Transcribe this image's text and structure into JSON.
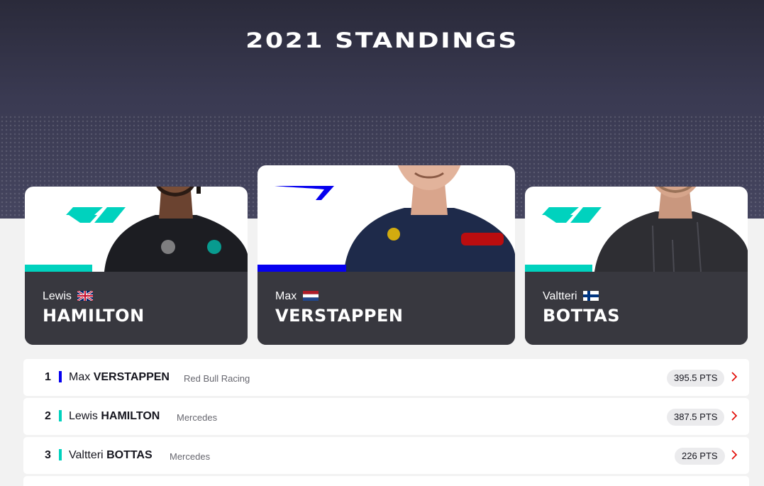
{
  "header": {
    "title": "2021 STANDINGS"
  },
  "colors": {
    "mercedes": "#00d2be",
    "redbull": "#0600ef",
    "card_dark": "#38383f",
    "accent_red": "#e10600"
  },
  "cards": [
    {
      "first_name": "Lewis",
      "last_name": "HAMILTON",
      "flag": "uk-flag-icon",
      "team_logo": "mercedes-logo-icon"
    },
    {
      "first_name": "Max",
      "last_name": "VERSTAPPEN",
      "flag": "netherlands-flag-icon",
      "team_logo": "redbull-logo-icon"
    },
    {
      "first_name": "Valtteri",
      "last_name": "BOTTAS",
      "flag": "finland-flag-icon",
      "team_logo": "mercedes-logo-icon"
    }
  ],
  "standings": [
    {
      "position": "1",
      "first_name": "Max",
      "last_name": "VERSTAPPEN",
      "team": "Red Bull Racing",
      "points": "395.5 PTS"
    },
    {
      "position": "2",
      "first_name": "Lewis",
      "last_name": "HAMILTON",
      "team": "Mercedes",
      "points": "387.5 PTS"
    },
    {
      "position": "3",
      "first_name": "Valtteri",
      "last_name": "BOTTAS",
      "team": "Mercedes",
      "points": "226 PTS"
    }
  ]
}
